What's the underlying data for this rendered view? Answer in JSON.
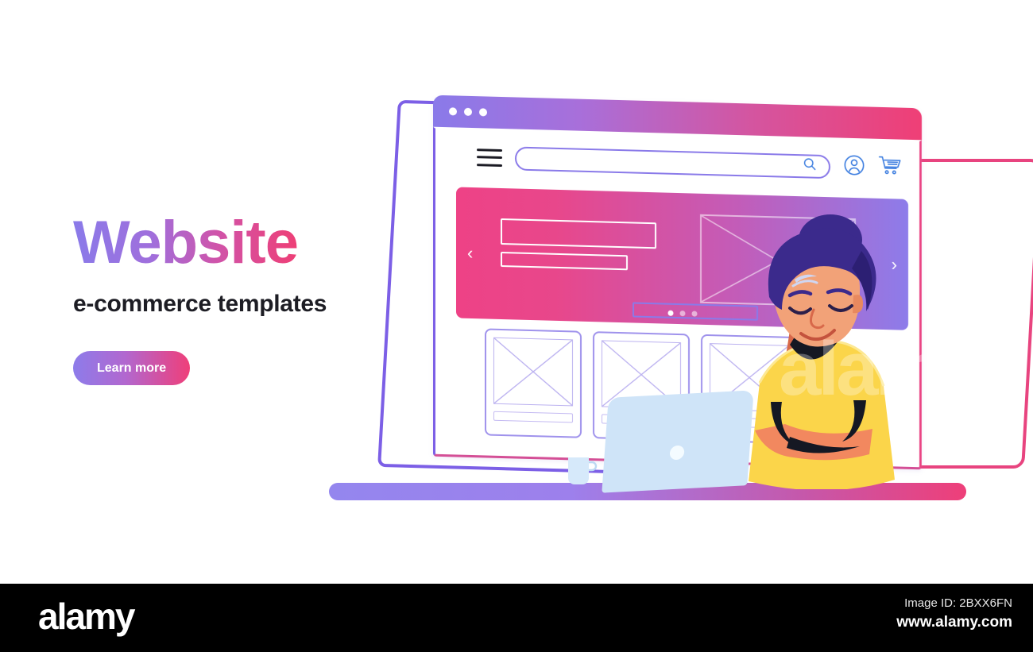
{
  "hero": {
    "headline": "Website",
    "subhead": "e-commerce templates",
    "cta_label": "Learn more",
    "headline_gradient_start": "#8a7ae9",
    "headline_gradient_end": "#ee3f76",
    "cta_gradient_start": "#8d7cea",
    "cta_gradient_end": "#ef3f79"
  },
  "browser": {
    "titlebar": {
      "gradient_start": "#8a7ae9",
      "gradient_end": "#ef3f76",
      "dots": [
        "dot-1",
        "dot-2",
        "dot-3"
      ]
    },
    "nav": {
      "menu_icon": "hamburger-menu-icon",
      "search_placeholder": "",
      "search_value": "",
      "search_icon": "magnifier-icon",
      "account_icon": "user-account-icon",
      "cart_icon": "shopping-cart-icon",
      "icon_color": "#3f7fe0",
      "outline_color": "#8a7ae9"
    },
    "carousel": {
      "prev_label": "‹",
      "next_label": "›",
      "gradient_start": "#ee4286",
      "gradient_end": "#8d7cea",
      "dots": [
        {
          "name": "slide-dot-1",
          "active": true
        },
        {
          "name": "slide-dot-2",
          "active": false
        },
        {
          "name": "slide-dot-3",
          "active": false
        }
      ],
      "headline_placeholder": "",
      "subline_placeholder": "",
      "image_placeholder": "image-placeholder-cross"
    },
    "section": {
      "title_placeholder": "",
      "products": [
        {
          "name": "product-card-1",
          "image_placeholder": "image-placeholder-cross",
          "caption_placeholder": ""
        },
        {
          "name": "product-card-2",
          "image_placeholder": "image-placeholder-cross",
          "caption_placeholder": ""
        },
        {
          "name": "product-card-3",
          "image_placeholder": "image-placeholder-cross",
          "caption_placeholder": ""
        }
      ]
    }
  },
  "scene": {
    "desk_gradient_start": "#9486ee",
    "desk_gradient_end": "#ee3f79",
    "laptop_color": "#cfe4f8",
    "mug_color": "#d6e9fa",
    "person": {
      "name": "woman-working-on-laptop",
      "hair_color": "#3b2a8c",
      "shirt_color": "#fbd54a",
      "skin_color": "#f2885f"
    },
    "frame_pink_color": "#e8447f",
    "frame_purple_color": "#7c5fe6"
  },
  "watermark": {
    "overlay_text": "alamy"
  },
  "footer": {
    "logo": "alamy",
    "image_id": "Image ID: 2BXX6FN",
    "url": "www.alamy.com"
  }
}
